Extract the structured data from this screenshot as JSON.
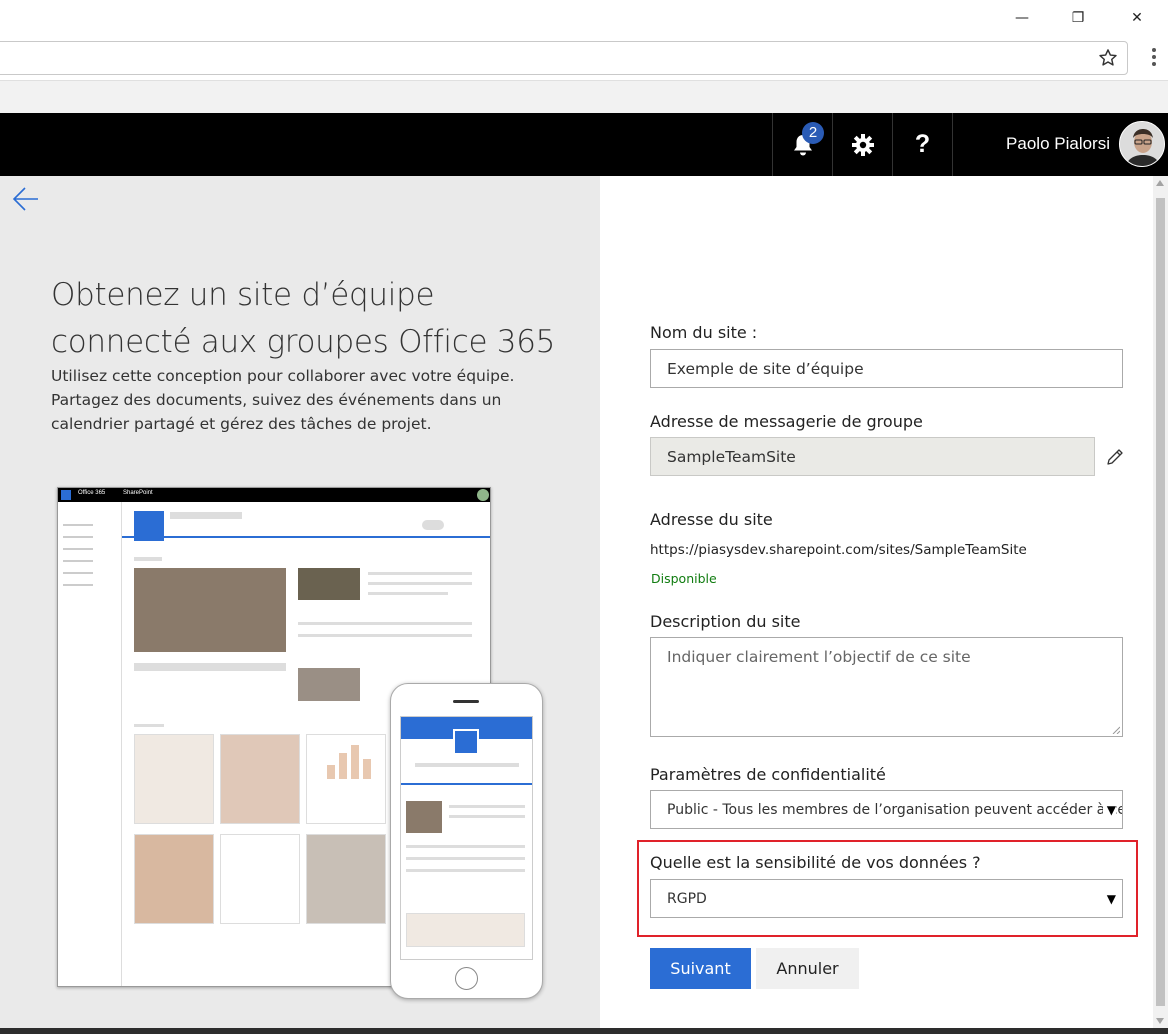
{
  "browser": {
    "minimize": "—",
    "restore": "❐",
    "close": "✕",
    "star_icon": "star-icon",
    "menu_icon": "more-vertical-icon"
  },
  "suite_bar": {
    "notification_count": "2",
    "settings_icon": "gear-icon",
    "help_label": "?",
    "user_name": "Paolo Pialorsi"
  },
  "intro": {
    "headline": "Obtenez un site d’équipe connecté aux groupes Office 365",
    "description": "Utilisez cette conception pour collaborer avec votre équipe. Partagez des documents, suivez des événements dans un calendrier partagé et gérez des tâches de projet."
  },
  "illustration": {
    "app_name": "Office 365",
    "product_name": "SharePoint"
  },
  "form": {
    "site_name_label": "Nom du site :",
    "site_name_value": "Exemple de site d’équipe",
    "group_email_label": "Adresse de messagerie de groupe",
    "group_email_value": "SampleTeamSite",
    "site_address_label": "Adresse du site",
    "site_address_value": "https://piasysdev.sharepoint.com/sites/SampleTeamSite",
    "availability": "Disponible",
    "description_label": "Description du site",
    "description_placeholder": "Indiquer clairement l’objectif de ce site",
    "privacy_label": "Paramètres de confidentialité",
    "privacy_value": "Public - Tous les membres de l’organisation peuvent accéder à ce site",
    "sensitivity_label": "Quelle est la sensibilité de vos données ?",
    "sensitivity_value": "RGPD",
    "next_button": "Suivant",
    "cancel_button": "Annuler"
  },
  "colors": {
    "primary": "#2b6dd4",
    "highlight": "#e0222a",
    "available": "#107c10",
    "suite_bar": "#000000"
  }
}
